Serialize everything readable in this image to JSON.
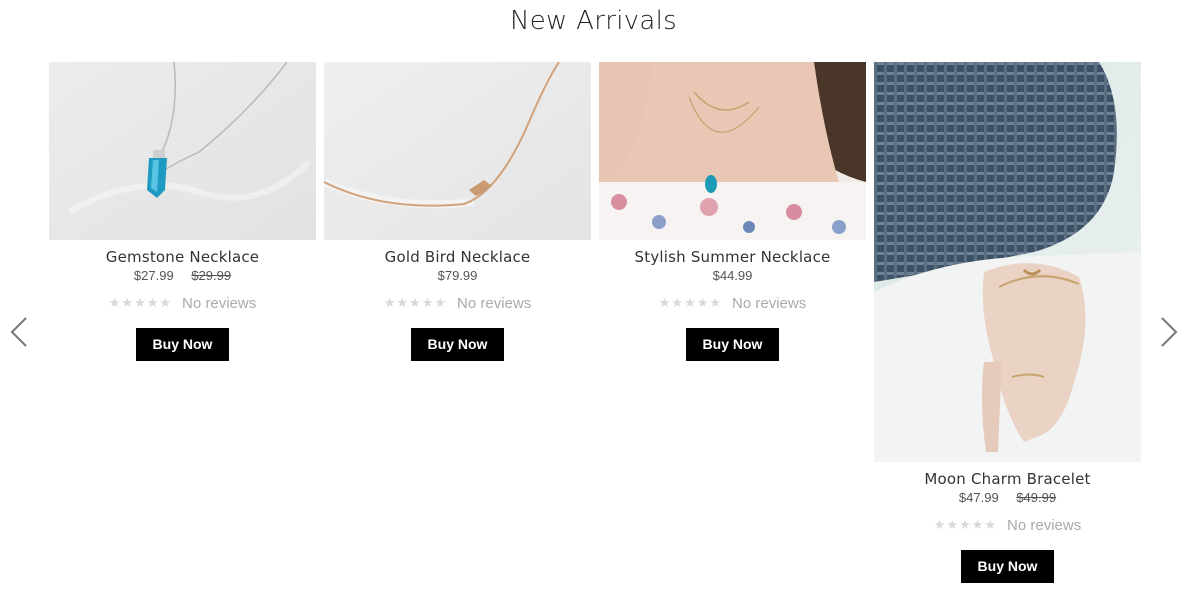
{
  "section": {
    "title": "New Arrivals"
  },
  "carousel": {
    "prev_icon": "chevron-left-icon",
    "next_icon": "chevron-right-icon"
  },
  "products": [
    {
      "title": "Gemstone Necklace",
      "price": "$27.99",
      "compare_price": "$29.99",
      "reviews": "No reviews",
      "stars": "★★★★★",
      "button": "Buy Now"
    },
    {
      "title": "Gold Bird Necklace",
      "price": "$79.99",
      "compare_price": "",
      "reviews": "No reviews",
      "stars": "★★★★★",
      "button": "Buy Now"
    },
    {
      "title": "Stylish Summer Necklace",
      "price": "$44.99",
      "compare_price": "",
      "reviews": "No reviews",
      "stars": "★★★★★",
      "button": "Buy Now"
    },
    {
      "title": "Moon Charm Bracelet",
      "price": "$47.99",
      "compare_price": "$49.99",
      "reviews": "No reviews",
      "stars": "★★★★★",
      "button": "Buy Now"
    }
  ],
  "colors": {
    "button_bg": "#000000",
    "button_text": "#ffffff",
    "star_empty": "#d8d8d8",
    "muted_text": "#aaaaaa"
  }
}
